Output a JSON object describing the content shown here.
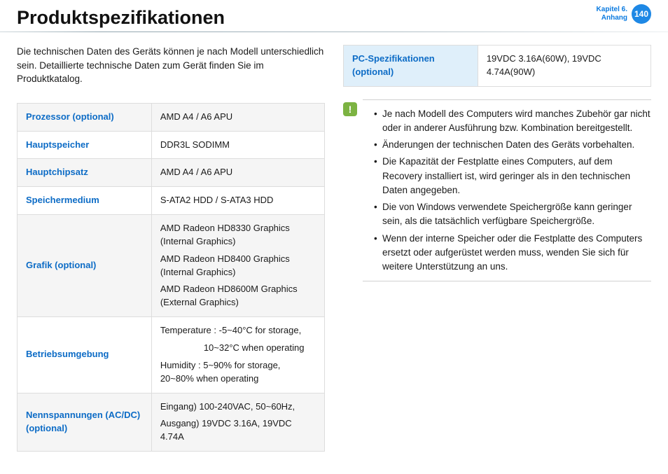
{
  "header": {
    "title": "Produktspezifikationen",
    "chapter_line1": "Kapitel 6.",
    "chapter_line2": "Anhang",
    "page": "140"
  },
  "intro": "Die technischen Daten des Geräts können je nach Modell unterschiedlich sein.  Detaillierte technische Daten zum Gerät finden Sie im Produktkatalog.",
  "spec_left": [
    {
      "k": "Prozessor (optional)",
      "v": "AMD A4 / A6 APU"
    },
    {
      "k": "Hauptspeicher",
      "v": "DDR3L SODIMM"
    },
    {
      "k": "Hauptchipsatz",
      "v": "AMD A4 / A6 APU"
    },
    {
      "k": "Speichermedium",
      "v": "S-ATA2 HDD / S-ATA3 HDD"
    },
    {
      "k": "Grafik (optional)",
      "v_lines": [
        "AMD Radeon HD8330 Graphics (Internal Graphics)",
        "AMD Radeon HD8400 Graphics (Internal Graphics)",
        "AMD Radeon HD8600M Graphics (External Graphics)"
      ]
    },
    {
      "k": "Betriebsumgebung",
      "v_lines": [
        "Temperature : -5~40°C for storage,",
        "10~32°C when operating",
        "Humidity : 5~90% for storage, 20~80% when operating"
      ],
      "indent_idx": [
        1
      ]
    },
    {
      "k": "Nennspannungen (AC/DC) (optional)",
      "v_lines": [
        "Eingang)  100-240VAC, 50~60Hz,",
        "Ausgang)  19VDC 3.16A, 19VDC 4.74A"
      ]
    }
  ],
  "spec_right": [
    {
      "k": "PC-Spezifikationen (optional)",
      "v": "19VDC 3.16A(60W), 19VDC 4.74A(90W)"
    }
  ],
  "note_icon": "!",
  "notes": [
    "Je nach Modell des Computers wird manches Zubehör gar nicht oder in anderer Ausführung bzw. Kombination bereitgestellt.",
    "Änderungen der technischen Daten des Geräts vorbehalten.",
    "Die Kapazität der Festplatte eines Computers, auf dem Recovery installiert ist, wird geringer als in den technischen Daten angegeben.",
    "Die von Windows verwendete Speichergröße kann geringer sein, als die tatsächlich verfügbare Speichergröße.",
    "Wenn der interne Speicher oder die Festplatte des Computers ersetzt oder aufgerüstet werden muss, wenden Sie sich für weitere Unterstützung an uns."
  ]
}
